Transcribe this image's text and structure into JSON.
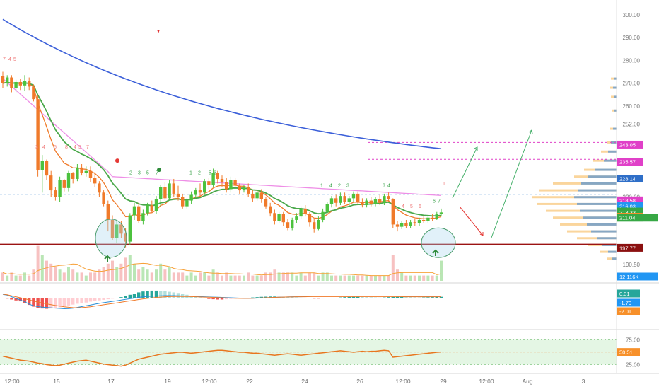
{
  "chart_data": {
    "type": "candlestick",
    "symbol": "ETHUSD",
    "price_axis": {
      "range": [
        183,
        304
      ],
      "ticks": [
        "300.00",
        "290.00",
        "280.00",
        "270.00",
        "260.00",
        "252.00",
        "220.00",
        "190.50"
      ],
      "tick_values": [
        300,
        290,
        280,
        270,
        260,
        252,
        220,
        190.5
      ]
    },
    "price_badges": [
      {
        "label": "243.05",
        "value": 243.05,
        "color": "#e040c8"
      },
      {
        "label": "235.57",
        "value": 235.57,
        "color": "#e040c8"
      },
      {
        "label": "228.14",
        "value": 228.14,
        "color": "#2f6fc8"
      },
      {
        "label": "218.58",
        "value": 218.58,
        "color": "#e040c8"
      },
      {
        "label": "216.03",
        "value": 216.03,
        "color": "#2196f3"
      },
      {
        "label": "ETHUSD",
        "value": 213.7,
        "color": "#37a845"
      },
      {
        "label": "213.33",
        "value": 213.33,
        "color": "#37a845"
      },
      {
        "label": "22:42:46",
        "value": 211.0,
        "color": "#37a845"
      },
      {
        "label": "211.38",
        "value": 211.38,
        "color": "#f7902a"
      },
      {
        "label": "211.04",
        "value": 211.04,
        "color": "#37a845"
      },
      {
        "label": "197.77",
        "value": 197.77,
        "color": "#8b1010"
      },
      {
        "label": "12.116K",
        "value": 187,
        "color": "#2196f3"
      }
    ],
    "levels": {
      "support": 199.3,
      "dashed_pink": [
        244.0,
        236.6
      ],
      "dashed_blue": 221.2
    },
    "x_axis": {
      "labels": [
        "12:00",
        "15",
        "17",
        "19",
        "12:00",
        "22",
        "24",
        "26",
        "12:00",
        "29",
        "12:00",
        "Aug",
        "3"
      ]
    },
    "candles": [
      [
        273.0,
        270.0,
        275.0,
        268.0
      ],
      [
        270.0,
        272.5,
        273.5,
        268.5
      ],
      [
        272.5,
        268.0,
        273.5,
        266.0
      ],
      [
        268.0,
        270.5,
        271.5,
        266.0
      ],
      [
        270.5,
        269.0,
        272.0,
        267.0
      ],
      [
        269.0,
        271.0,
        273.5,
        266.5
      ],
      [
        271.0,
        268.5,
        272.5,
        267.0
      ],
      [
        268.5,
        263.0,
        269.5,
        262.0
      ],
      [
        263.0,
        232.0,
        264.5,
        229.0
      ],
      [
        232.0,
        236.0,
        238.5,
        222.0
      ],
      [
        236.0,
        229.5,
        236.5,
        227.5
      ],
      [
        229.5,
        223.0,
        231.5,
        220.0
      ],
      [
        223.0,
        220.0,
        224.5,
        218.5
      ],
      [
        220.0,
        227.5,
        229.0,
        218.0
      ],
      [
        227.5,
        224.0,
        228.0,
        222.5
      ],
      [
        224.0,
        230.5,
        231.5,
        222.5
      ],
      [
        230.5,
        228.0,
        231.0,
        226.0
      ],
      [
        228.0,
        233.0,
        234.5,
        227.0
      ],
      [
        233.0,
        230.5,
        234.5,
        229.5
      ],
      [
        230.5,
        231.5,
        233.5,
        229.0
      ],
      [
        231.5,
        228.5,
        233.5,
        226.5
      ],
      [
        228.5,
        226.0,
        231.0,
        224.5
      ],
      [
        226.0,
        222.0,
        227.0,
        220.0
      ],
      [
        222.0,
        217.0,
        223.0,
        216.0
      ],
      [
        217.0,
        210.0,
        218.5,
        205.0
      ],
      [
        210.0,
        202.0,
        212.0,
        201.0
      ],
      [
        202.0,
        208.0,
        210.0,
        200.0
      ],
      [
        208.0,
        204.0,
        209.5,
        202.0
      ],
      [
        204.0,
        200.5,
        206.5,
        198.0
      ],
      [
        200.5,
        212.0,
        213.0,
        199.0
      ],
      [
        212.0,
        216.0,
        217.5,
        210.0
      ],
      [
        216.0,
        209.5,
        217.5,
        208.5
      ],
      [
        209.5,
        213.0,
        214.5,
        208.0
      ],
      [
        213.0,
        216.5,
        217.5,
        212.0
      ],
      [
        216.5,
        214.0,
        218.5,
        213.0
      ],
      [
        214.0,
        219.0,
        220.5,
        212.5
      ],
      [
        219.0,
        224.5,
        225.5,
        216.0
      ],
      [
        224.5,
        219.5,
        226.5,
        218.5
      ],
      [
        219.5,
        226.0,
        227.5,
        218.5
      ],
      [
        226.0,
        221.5,
        228.0,
        220.0
      ],
      [
        221.5,
        220.0,
        225.0,
        218.5
      ],
      [
        220.0,
        216.0,
        221.5,
        215.0
      ],
      [
        216.0,
        218.5,
        219.5,
        215.0
      ],
      [
        218.5,
        221.0,
        222.5,
        217.0
      ],
      [
        221.0,
        223.0,
        224.0,
        219.5
      ],
      [
        223.0,
        222.0,
        226.0,
        220.0
      ],
      [
        222.0,
        227.0,
        228.0,
        221.0
      ],
      [
        227.0,
        225.5,
        228.5,
        223.5
      ],
      [
        225.5,
        230.5,
        232.5,
        224.5
      ],
      [
        230.5,
        228.0,
        231.5,
        226.0
      ],
      [
        228.0,
        226.5,
        229.5,
        224.5
      ],
      [
        226.5,
        223.5,
        228.5,
        222.0
      ],
      [
        223.5,
        227.5,
        229.0,
        222.0
      ],
      [
        227.5,
        225.0,
        228.5,
        224.0
      ],
      [
        225.0,
        223.0,
        226.0,
        221.5
      ],
      [
        223.0,
        224.5,
        225.5,
        222.0
      ],
      [
        224.5,
        221.5,
        226.0,
        220.0
      ],
      [
        221.5,
        219.5,
        223.0,
        218.0
      ],
      [
        219.5,
        222.0,
        223.0,
        218.5
      ],
      [
        222.0,
        219.0,
        223.5,
        217.5
      ],
      [
        219.0,
        216.0,
        220.0,
        215.0
      ],
      [
        216.0,
        213.0,
        217.5,
        211.5
      ],
      [
        213.0,
        209.5,
        214.5,
        208.0
      ],
      [
        209.5,
        212.5,
        213.5,
        208.5
      ],
      [
        212.5,
        209.0,
        213.5,
        207.5
      ],
      [
        209.0,
        206.5,
        210.5,
        205.5
      ],
      [
        206.5,
        210.0,
        211.0,
        205.5
      ],
      [
        210.0,
        211.5,
        213.0,
        208.5
      ],
      [
        211.5,
        215.0,
        216.0,
        210.5
      ],
      [
        215.0,
        212.5,
        216.5,
        211.5
      ],
      [
        212.5,
        209.0,
        213.5,
        207.0
      ],
      [
        209.0,
        206.0,
        210.5,
        204.5
      ],
      [
        206.0,
        210.0,
        211.5,
        205.5
      ],
      [
        210.0,
        213.5,
        215.0,
        209.0
      ],
      [
        213.5,
        217.0,
        218.0,
        212.5
      ],
      [
        217.0,
        219.5,
        220.5,
        215.5
      ],
      [
        219.5,
        217.5,
        221.0,
        216.0
      ],
      [
        217.5,
        220.5,
        222.0,
        216.5
      ],
      [
        220.5,
        218.0,
        222.0,
        217.0
      ],
      [
        218.0,
        219.5,
        220.5,
        216.0
      ],
      [
        219.5,
        221.5,
        222.5,
        218.0
      ],
      [
        221.5,
        218.0,
        222.5,
        217.0
      ],
      [
        218.0,
        216.5,
        219.5,
        215.5
      ],
      [
        216.5,
        218.5,
        219.5,
        215.5
      ],
      [
        218.5,
        217.0,
        220.0,
        216.0
      ],
      [
        217.0,
        219.0,
        220.0,
        216.0
      ],
      [
        219.0,
        217.5,
        221.0,
        216.5
      ],
      [
        217.5,
        220.5,
        221.5,
        216.5
      ],
      [
        220.5,
        219.0,
        222.0,
        218.0
      ],
      [
        219.0,
        208.0,
        219.5,
        206.5
      ],
      [
        208.0,
        207.0,
        209.5,
        205.0
      ],
      [
        207.0,
        208.5,
        209.5,
        206.0
      ],
      [
        208.5,
        207.5,
        210.0,
        206.5
      ],
      [
        207.5,
        209.0,
        210.0,
        206.5
      ],
      [
        209.0,
        208.5,
        210.5,
        207.5
      ],
      [
        208.5,
        210.0,
        211.0,
        207.5
      ],
      [
        210.0,
        209.5,
        211.5,
        208.5
      ],
      [
        209.5,
        211.0,
        212.0,
        208.5
      ],
      [
        211.0,
        210.5,
        212.5,
        209.5
      ],
      [
        210.5,
        212.5,
        213.5,
        210.0
      ],
      [
        212.5,
        213.3,
        215.0,
        211.5
      ]
    ],
    "volume": [
      3,
      2,
      3,
      2,
      2,
      3,
      2,
      4,
      12,
      9,
      7,
      6,
      5,
      4,
      3,
      5,
      4,
      3,
      3,
      2,
      3,
      3,
      4,
      5,
      6,
      7,
      5,
      6,
      8,
      9,
      6,
      4,
      5,
      4,
      3,
      4,
      6,
      4,
      5,
      3,
      3,
      3,
      2,
      3,
      2,
      3,
      3,
      2,
      4,
      3,
      2,
      3,
      2,
      2,
      2,
      2,
      3,
      2,
      2,
      2,
      3,
      3,
      4,
      3,
      3,
      3,
      3,
      2,
      3,
      2,
      3,
      3,
      2,
      3,
      3,
      2,
      2,
      2,
      2,
      2,
      2,
      2,
      2,
      2,
      2,
      2,
      2,
      2,
      2,
      9,
      4,
      3,
      2,
      2,
      2,
      2,
      2,
      2,
      2,
      2,
      7
    ],
    "macd": {
      "histogram": [
        0,
        -0.3,
        -0.6,
        -0.9,
        -1.2,
        -1.8,
        -2.4,
        -3.0,
        -3.4,
        -3.6,
        -3.7,
        -3.6,
        -3.4,
        -3.2,
        -2.9,
        -2.6,
        -2.3,
        -2.0,
        -1.8,
        -1.6,
        -1.3,
        -1.1,
        -0.9,
        -0.7,
        -0.5,
        -0.3,
        -0.1,
        0.2,
        0.6,
        1.0,
        1.4,
        1.8,
        2.1,
        2.3,
        2.4,
        2.4,
        2.3,
        2.2,
        2.0,
        1.8,
        1.6,
        1.3,
        1.0,
        0.7,
        0.4,
        0.1,
        -0.2,
        -0.4,
        -0.5,
        -0.6,
        -0.6,
        -0.5,
        -0.4,
        -0.3,
        -0.2,
        -0.1,
        0,
        0.1,
        0.2,
        0.3,
        0.35,
        0.4,
        0.4,
        0.35,
        0.3,
        0.25,
        0.2,
        0.1,
        0,
        -0.1,
        -0.2,
        -0.3,
        -0.3,
        -0.25,
        -0.2,
        -0.1,
        0,
        0.1,
        0.2,
        0.25,
        0.3,
        0.3,
        0.25,
        0.2,
        0.15,
        0.1,
        0.05,
        0.1,
        0.2,
        0.25,
        0.3,
        0.3,
        0.25,
        0.2,
        0.15,
        0.1,
        0.1,
        0.15,
        0.2,
        0.25,
        0.31
      ],
      "macd_line": [
        -0.5,
        -1,
        -2,
        -3,
        -4,
        -5,
        -6.5,
        -7.5,
        -8,
        -8.3,
        -8.5,
        -8.7,
        -8.9,
        -9.1,
        -9.3,
        -9.2,
        -9.0,
        -8.5,
        -8,
        -7.5,
        -7,
        -6.5,
        -6,
        -5.6,
        -5.2,
        -4.8,
        -4.4,
        -4,
        -3.6,
        -3.2,
        -2.8,
        -2.4,
        -2,
        -1.8,
        -1.6,
        -1.5,
        -1.4,
        -1.3,
        -1.3,
        -1.3,
        -1.4,
        -1.5,
        -1.6,
        -1.7,
        -1.8,
        -1.9,
        -2,
        -2.1,
        -2.2,
        -2.3,
        -2.4,
        -2.5,
        -2.6,
        -2.7,
        -2.8,
        -2.9,
        -2.9,
        -2.9,
        -2.8,
        -2.7,
        -2.6,
        -2.5,
        -2.4,
        -2.3,
        -2.2,
        -2.1,
        -2.0,
        -2.0,
        -2.0,
        -1.9,
        -1.8,
        -1.7,
        -1.6,
        -1.6,
        -1.6,
        -1.7,
        -1.7,
        -1.7,
        -1.7,
        -1.7,
        -1.7,
        -1.7,
        -1.7,
        -1.7,
        -1.7,
        -1.7,
        -1.7,
        -1.7,
        -1.7,
        -1.7,
        -1.7,
        -1.7,
        -1.7,
        -1.7,
        -1.7,
        -1.7,
        -1.7,
        -1.7,
        -1.7,
        -1.7,
        -1.7
      ],
      "signal_line": [
        -0.4,
        -0.8,
        -1.4,
        -2,
        -2.6,
        -3.2,
        -3.9,
        -4.6,
        -5.2,
        -5.8,
        -6.3,
        -6.8,
        -7.3,
        -7.7,
        -8.1,
        -8.4,
        -8.6,
        -8.7,
        -8.6,
        -8.4,
        -8.1,
        -7.7,
        -7.3,
        -6.9,
        -6.5,
        -6.1,
        -5.7,
        -5.3,
        -4.9,
        -4.5,
        -4.1,
        -3.7,
        -3.3,
        -3.0,
        -2.7,
        -2.4,
        -2.2,
        -2.0,
        -1.9,
        -1.8,
        -1.8,
        -1.8,
        -1.8,
        -1.9,
        -2.0,
        -2.1,
        -2.2,
        -2.3,
        -2.4,
        -2.5,
        -2.6,
        -2.7,
        -2.8,
        -2.9,
        -3.0,
        -3.0,
        -3.0,
        -2.9,
        -2.8,
        -2.7,
        -2.6,
        -2.5,
        -2.4,
        -2.3,
        -2.2,
        -2.1,
        -2.1,
        -2.0,
        -2.0,
        -2.0,
        -1.9,
        -1.9,
        -1.9,
        -1.9,
        -1.9,
        -1.9,
        -1.9,
        -1.9,
        -1.9,
        -1.9,
        -1.9,
        -1.9,
        -1.9,
        -1.9,
        -1.9,
        -1.9,
        -1.9,
        -1.9,
        -1.9,
        -1.9,
        -1.9,
        -1.9,
        -2.0,
        -2.0,
        -2.0,
        -2.0,
        -2.0,
        -2.0,
        -2.0,
        -2.0,
        -2.01
      ],
      "labels": [
        "0.31",
        "-1.70",
        "-2.01"
      ]
    },
    "rsi": {
      "ticks": [
        "75.00",
        "25.00"
      ],
      "tick_values": [
        75,
        25
      ],
      "current_label": "50.51",
      "current": 50.51,
      "values": [
        42,
        40,
        38,
        36,
        34,
        33,
        32,
        30,
        28,
        27,
        25,
        24,
        23,
        24,
        26,
        28,
        30,
        32,
        33,
        34,
        32,
        30,
        28,
        26,
        25,
        24,
        23,
        22,
        24,
        28,
        32,
        36,
        38,
        40,
        42,
        44,
        46,
        47,
        48,
        49,
        50,
        50,
        49,
        48,
        49,
        50,
        51,
        52,
        53,
        54,
        54,
        53,
        52,
        51,
        50,
        50,
        49,
        48,
        48,
        47,
        46,
        45,
        44,
        45,
        46,
        47,
        46,
        45,
        44,
        45,
        46,
        47,
        48,
        49,
        50,
        51,
        52,
        53,
        52,
        51,
        50,
        51,
        52,
        51,
        52,
        52,
        53,
        54,
        53,
        40,
        41,
        42,
        43,
        44,
        45,
        46,
        47,
        48,
        49,
        50,
        50.5
      ]
    }
  }
}
